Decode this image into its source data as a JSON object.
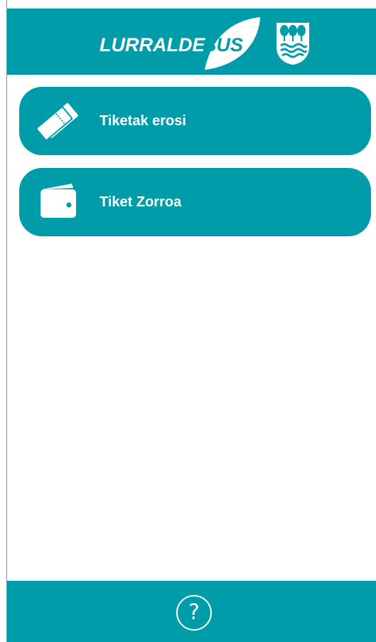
{
  "header": {
    "brand": "LURRALDEBUS",
    "brand_part1": "LURRALDE",
    "brand_part2": "BUS",
    "coat_of_arms_icon": "gipuzkoa-coat-of-arms-icon"
  },
  "menu": [
    {
      "label": "Tiketak erosi",
      "icon": "ticket-icon"
    },
    {
      "label": "Tiket Zorroa",
      "icon": "wallet-icon"
    }
  ],
  "footer": {
    "help_symbol": "?",
    "help_icon": "help-icon"
  },
  "colors": {
    "primary": "#009ca9",
    "background": "#ffffff",
    "text_on_primary": "#ffffff"
  }
}
